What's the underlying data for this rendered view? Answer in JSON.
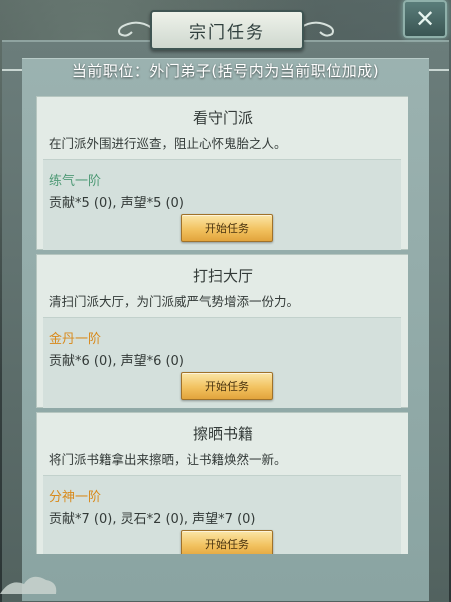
{
  "dialog": {
    "title": "宗门任务",
    "rank_text": "当前职位：外门弟子(括号内为当前职位加成)"
  },
  "tasks": [
    {
      "name": "看守门派",
      "desc": "在门派外围进行巡查，阻止心怀鬼胎之人。",
      "tier": "练气一阶",
      "tier_color": "#4f9a76",
      "reward": "贡献*5 (0), 声望*5 (0)",
      "button": "开始任务"
    },
    {
      "name": "打扫大厅",
      "desc": "清扫门派大厅，为门派威严气势增添一份力。",
      "tier": "金丹一阶",
      "tier_color": "#d88a1c",
      "reward": "贡献*6 (0), 声望*6 (0)",
      "button": "开始任务"
    },
    {
      "name": "擦晒书籍",
      "desc": "将门派书籍拿出来擦晒，让书籍焕然一新。",
      "tier": "分神一阶",
      "tier_color": "#d88a1c",
      "reward": "贡献*7 (0), 灵石*2 (0), 声望*7 (0)",
      "button": "开始任务"
    }
  ],
  "icons": {
    "close": "close-x-icon"
  },
  "colors": {
    "frame": "#52625f",
    "panel": "#8aa4a2",
    "card": "#e3ebe6",
    "button_gold": "#f2c260"
  }
}
